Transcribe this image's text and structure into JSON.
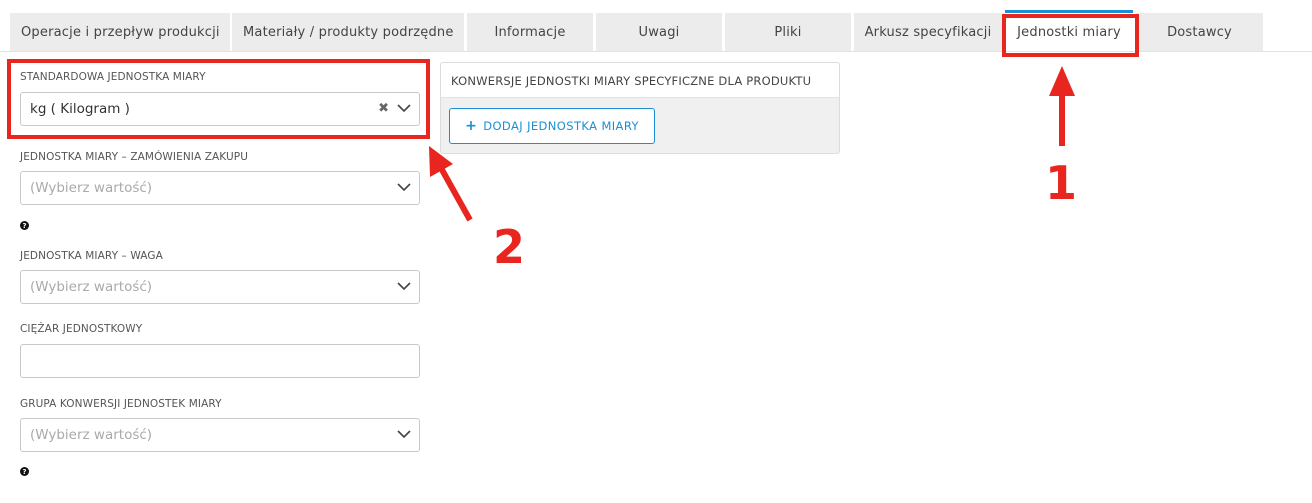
{
  "tabs": [
    {
      "label": "Operacje i przepływ produkcji",
      "active": false
    },
    {
      "label": "Materiały / produkty podrzędne",
      "active": false
    },
    {
      "label": "Informacje",
      "active": false
    },
    {
      "label": "Uwagi",
      "active": false
    },
    {
      "label": "Pliki",
      "active": false
    },
    {
      "label": "Arkusz specyfikacji",
      "active": false
    },
    {
      "label": "Jednostki miary",
      "active": true
    },
    {
      "label": "Dostawcy",
      "active": false
    }
  ],
  "form": {
    "standard_uom": {
      "label": "STANDARDOWA JEDNOSTKA MIARY",
      "value": "kg  ( Kilogram )"
    },
    "purchase_uom": {
      "label": "JEDNOSTKA MIARY – ZAMÓWIENIA ZAKUPU",
      "placeholder": "(Wybierz wartość)"
    },
    "weight_uom": {
      "label": "JEDNOSTKA MIARY – WAGA",
      "placeholder": "(Wybierz wartość)"
    },
    "unit_weight": {
      "label": "CIĘŻAR JEDNOSTKOWY",
      "value": ""
    },
    "conversion_group": {
      "label": "GRUPA KONWERSJI JEDNOSTEK MIARY",
      "placeholder": "(Wybierz wartość)"
    }
  },
  "panel": {
    "title": "KONWERSJE JEDNOSTKI MIARY SPECYFICZNE DLA PRODUKTU",
    "add_button": "DODAJ JEDNOSTKA MIARY"
  },
  "annotations": {
    "label_1": "1",
    "label_2": "2"
  },
  "colors": {
    "accent": "#1a8fd6",
    "annotation": "#e8261f"
  }
}
